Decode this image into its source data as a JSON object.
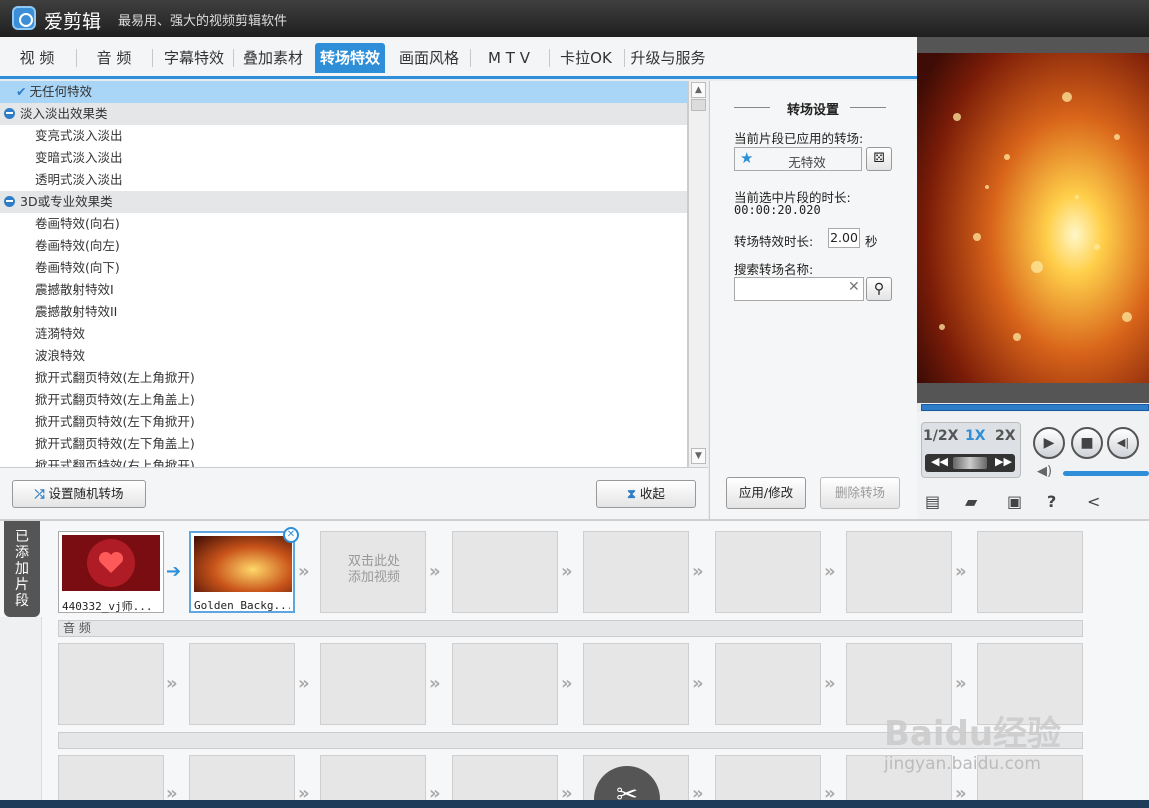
{
  "app": {
    "name": "爱剪辑",
    "slogan": "最易用、强大的视频剪辑软件"
  },
  "tabs": [
    {
      "label": "视 频",
      "active": false
    },
    {
      "label": "音 频",
      "active": false
    },
    {
      "label": "字幕特效",
      "active": false
    },
    {
      "label": "叠加素材",
      "active": false
    },
    {
      "label": "转场特效",
      "active": true
    },
    {
      "label": "画面风格",
      "active": false
    },
    {
      "label": "M T V",
      "active": false
    },
    {
      "label": "卡拉OK",
      "active": false
    },
    {
      "label": "升级与服务",
      "active": false
    }
  ],
  "effects": {
    "selected": "无任何特效",
    "categories": [
      {
        "name": "淡入淡出效果类",
        "items": [
          "变亮式淡入淡出",
          "变暗式淡入淡出",
          "透明式淡入淡出"
        ]
      },
      {
        "name": "3D或专业效果类",
        "items": [
          "卷画特效(向右)",
          "卷画特效(向左)",
          "卷画特效(向下)",
          "震撼散射特效I",
          "震撼散射特效II",
          "涟漪特效",
          "波浪特效",
          "掀开式翻页特效(左上角掀开)",
          "掀开式翻页特效(左上角盖上)",
          "掀开式翻页特效(左下角掀开)",
          "掀开式翻页特效(左下角盖上)",
          "掀开式翻页特效(右上角掀开)"
        ]
      }
    ]
  },
  "list_buttons": {
    "random": "设置随机转场",
    "collapse": "收起"
  },
  "settings": {
    "title": "转场设置",
    "applied_label": "当前片段已应用的转场:",
    "applied_value": "无特效",
    "duration_label": "当前选中片段的时长:",
    "duration_value": "00:00:20.020",
    "effect_duration_label": "转场特效时长:",
    "effect_duration_value": "2.00",
    "seconds": "秒",
    "search_label": "搜索转场名称:",
    "search_value": "",
    "apply": "应用/修改",
    "delete": "删除转场"
  },
  "player": {
    "speeds": [
      "1/2X",
      "1X",
      "2X"
    ],
    "active_speed": "1X"
  },
  "timeline": {
    "side_label": "已添加片段",
    "clips": [
      {
        "name": "440332_vj师..."
      },
      {
        "name": "Golden Backg..."
      }
    ],
    "add_hint_line1": "双击此处",
    "add_hint_line2": "添加视频",
    "audio_label": "音 频"
  },
  "watermark": {
    "brand": "Baidu经验",
    "url": "jingyan.baidu.com"
  },
  "colors": {
    "accent": "#2e8fd8",
    "selection": "#a9d6f7"
  }
}
